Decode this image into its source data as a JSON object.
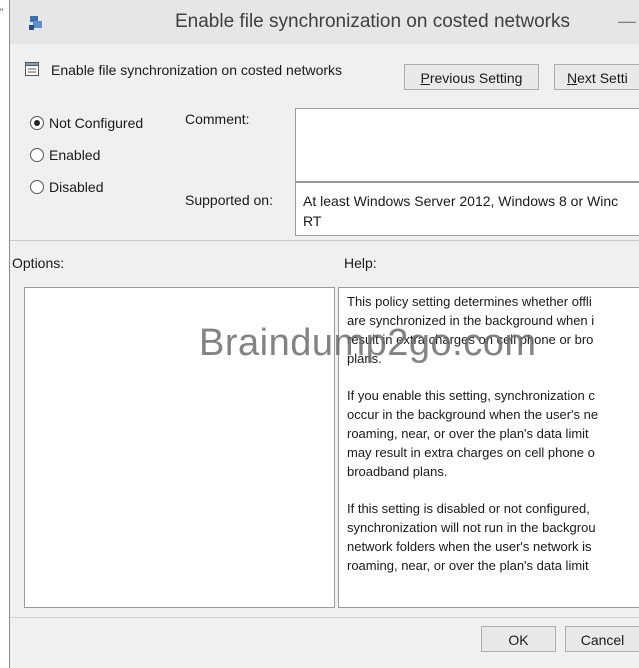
{
  "stray_mark": "\"",
  "window": {
    "title": "Enable file synchronization on costed networks",
    "minimize_glyph": "—"
  },
  "header": {
    "setting_name": "Enable file synchronization on costed networks",
    "previous_button": "Previous Setting",
    "next_button": "Next Setti"
  },
  "state": {
    "options": [
      {
        "label": "Not Configured",
        "selected": true
      },
      {
        "label": "Enabled",
        "selected": false
      },
      {
        "label": "Disabled",
        "selected": false
      }
    ]
  },
  "comment": {
    "label": "Comment:",
    "value": ""
  },
  "supported": {
    "label": "Supported on:",
    "value": "At least Windows Server 2012, Windows 8 or Winc\nRT"
  },
  "options_panel": {
    "label": "Options:"
  },
  "help_panel": {
    "label": "Help:",
    "paragraphs": [
      "This policy setting determines whether offli\nare synchronized in the background when i\nresult in extra charges on cell phone or bro\nplans.",
      "If you enable this setting, synchronization c\noccur in the background when the user's ne\nroaming, near, or over the plan's data limit\nmay result in extra charges on cell phone o\nbroadband plans.",
      "If this setting is disabled or not configured,\nsynchronization will not run in the backgrou\nnetwork folders when the user's network is\nroaming, near, or over the plan's data limit"
    ]
  },
  "footer": {
    "ok_button": "OK",
    "cancel_button": "Cancel"
  },
  "watermark": "Braindump2go.com",
  "icons": {
    "title_icon": "group-policy-icon",
    "header_icon": "policy-setting-icon"
  }
}
